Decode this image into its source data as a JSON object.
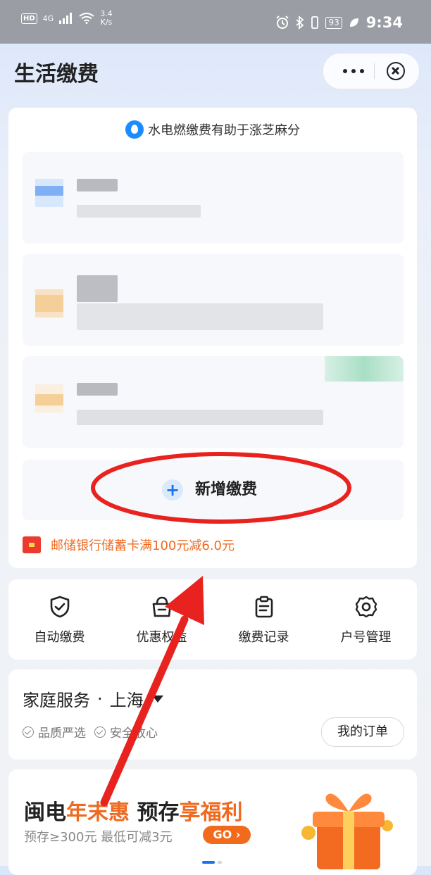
{
  "status_bar": {
    "hd": "HD",
    "signal": "4G",
    "speed_value": "3.4",
    "speed_unit": "K/s",
    "battery": "93",
    "time": "9:34"
  },
  "header": {
    "title": "生活缴费"
  },
  "main_card": {
    "sesame_text": "水电燃缴费有助于涨芝麻分",
    "add_label": "新增缴费",
    "add_plus": "+",
    "promo_text": "邮储银行储蓄卡满100元减6.0元"
  },
  "quick_actions": [
    {
      "label": "自动缴费",
      "icon": "shield-check-icon"
    },
    {
      "label": "优惠权益",
      "icon": "gift-basket-icon"
    },
    {
      "label": "缴费记录",
      "icon": "clipboard-icon"
    },
    {
      "label": "户号管理",
      "icon": "gear-icon"
    }
  ],
  "home_service": {
    "title": "家庭服务",
    "separator": "·",
    "city": "上海",
    "tags": [
      "品质严选",
      "安全放心"
    ],
    "orders_button": "我的订单"
  },
  "banner": {
    "title_part1": "闽电",
    "title_highlight1": "年末惠",
    "title_part2": " 预存",
    "title_highlight2": "享福利",
    "subtitle": "预存≥300元 最低可减3元",
    "go_button": "GO ›"
  },
  "colors": {
    "accent_blue": "#1a73e8",
    "promo_orange": "#ef6a20",
    "annotation_red": "#e8231f"
  }
}
